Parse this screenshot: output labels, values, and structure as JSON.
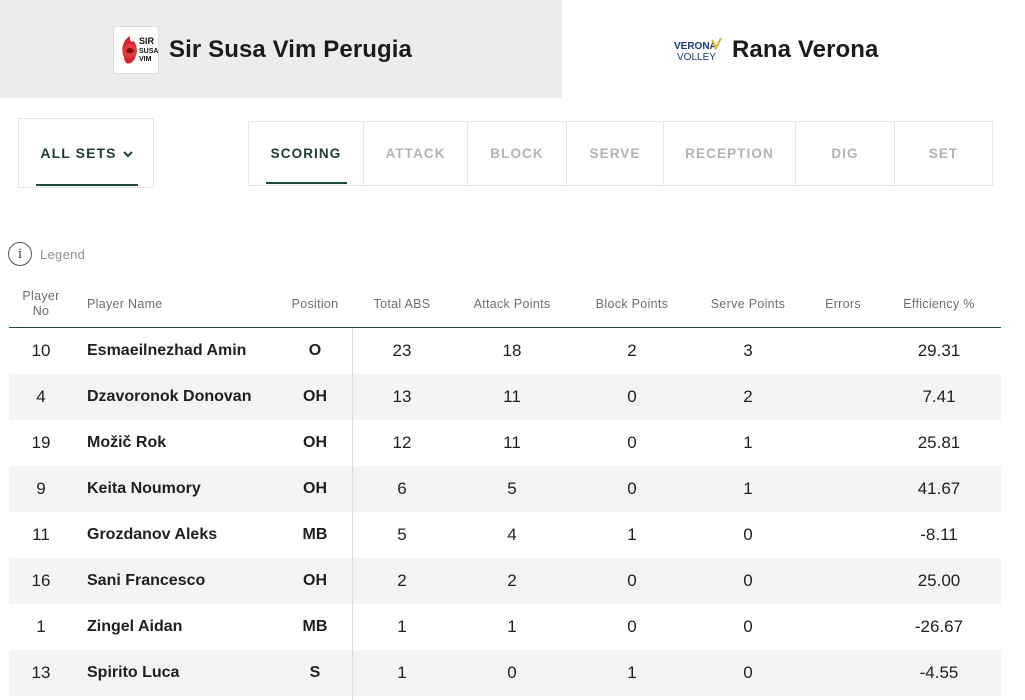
{
  "teams": {
    "home": {
      "name": "Sir Susa Vim Perugia",
      "logo_lines": [
        "SIR",
        "SUSA",
        "VIM"
      ],
      "color": "#d8232a"
    },
    "away": {
      "name": "Rana Verona",
      "logo_lines": [
        "VERONA",
        "VOLLEY"
      ],
      "color": "#1f3a7a"
    }
  },
  "sets": {
    "label": "ALL SETS",
    "icon": "chevron-down-icon"
  },
  "tabs": [
    {
      "label": "SCORING",
      "active": true
    },
    {
      "label": "ATTACK",
      "active": false
    },
    {
      "label": "BLOCK",
      "active": false
    },
    {
      "label": "SERVE",
      "active": false
    },
    {
      "label": "RECEPTION",
      "active": false
    },
    {
      "label": "DIG",
      "active": false
    },
    {
      "label": "SET",
      "active": false
    }
  ],
  "legend": {
    "label": "Legend",
    "icon": "info-icon"
  },
  "table": {
    "headers": {
      "no_line1": "Player",
      "no_line2": "No",
      "name": "Player Name",
      "position": "Position",
      "total": "Total ABS",
      "attack": "Attack Points",
      "block": "Block Points",
      "serve": "Serve Points",
      "errors": "Errors",
      "efficiency": "Efficiency %"
    },
    "rows": [
      {
        "no": "10",
        "name": "Esmaeilnezhad Amin",
        "position": "O",
        "total": "23",
        "attack": "18",
        "block": "2",
        "serve": "3",
        "errors": "",
        "efficiency": "29.31"
      },
      {
        "no": "4",
        "name": "Dzavoronok Donovan",
        "position": "OH",
        "total": "13",
        "attack": "11",
        "block": "0",
        "serve": "2",
        "errors": "",
        "efficiency": "7.41"
      },
      {
        "no": "19",
        "name": "Možič Rok",
        "position": "OH",
        "total": "12",
        "attack": "11",
        "block": "0",
        "serve": "1",
        "errors": "",
        "efficiency": "25.81"
      },
      {
        "no": "9",
        "name": "Keita Noumory",
        "position": "OH",
        "total": "6",
        "attack": "5",
        "block": "0",
        "serve": "1",
        "errors": "",
        "efficiency": "41.67"
      },
      {
        "no": "11",
        "name": "Grozdanov Aleks",
        "position": "MB",
        "total": "5",
        "attack": "4",
        "block": "1",
        "serve": "0",
        "errors": "",
        "efficiency": "-8.11"
      },
      {
        "no": "16",
        "name": "Sani Francesco",
        "position": "OH",
        "total": "2",
        "attack": "2",
        "block": "0",
        "serve": "0",
        "errors": "",
        "efficiency": "25.00"
      },
      {
        "no": "1",
        "name": "Zingel Aidan",
        "position": "MB",
        "total": "1",
        "attack": "1",
        "block": "0",
        "serve": "0",
        "errors": "",
        "efficiency": "-26.67"
      },
      {
        "no": "13",
        "name": "Spirito Luca",
        "position": "S",
        "total": "1",
        "attack": "0",
        "block": "1",
        "serve": "0",
        "errors": "",
        "efficiency": "-4.55"
      }
    ]
  }
}
